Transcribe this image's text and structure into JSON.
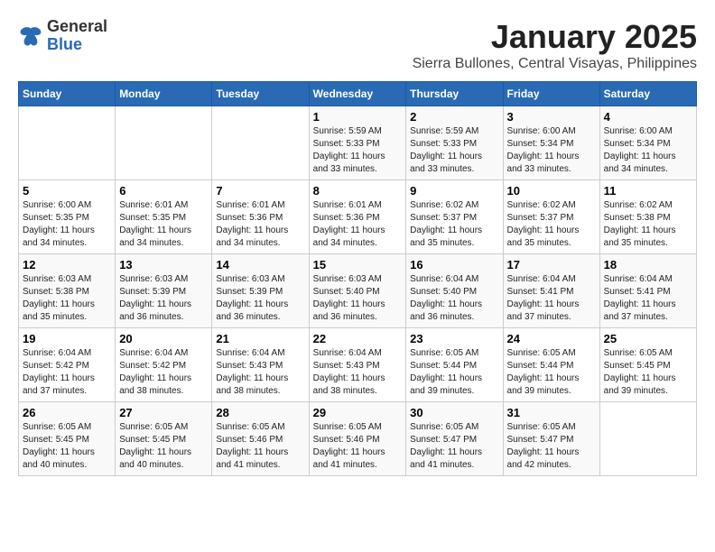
{
  "header": {
    "logo_general": "General",
    "logo_blue": "Blue",
    "month": "January 2025",
    "location": "Sierra Bullones, Central Visayas, Philippines"
  },
  "weekdays": [
    "Sunday",
    "Monday",
    "Tuesday",
    "Wednesday",
    "Thursday",
    "Friday",
    "Saturday"
  ],
  "weeks": [
    [
      {
        "day": "",
        "sunrise": "",
        "sunset": "",
        "daylight": ""
      },
      {
        "day": "",
        "sunrise": "",
        "sunset": "",
        "daylight": ""
      },
      {
        "day": "",
        "sunrise": "",
        "sunset": "",
        "daylight": ""
      },
      {
        "day": "1",
        "sunrise": "Sunrise: 5:59 AM",
        "sunset": "Sunset: 5:33 PM",
        "daylight": "Daylight: 11 hours and 33 minutes."
      },
      {
        "day": "2",
        "sunrise": "Sunrise: 5:59 AM",
        "sunset": "Sunset: 5:33 PM",
        "daylight": "Daylight: 11 hours and 33 minutes."
      },
      {
        "day": "3",
        "sunrise": "Sunrise: 6:00 AM",
        "sunset": "Sunset: 5:34 PM",
        "daylight": "Daylight: 11 hours and 33 minutes."
      },
      {
        "day": "4",
        "sunrise": "Sunrise: 6:00 AM",
        "sunset": "Sunset: 5:34 PM",
        "daylight": "Daylight: 11 hours and 34 minutes."
      }
    ],
    [
      {
        "day": "5",
        "sunrise": "Sunrise: 6:00 AM",
        "sunset": "Sunset: 5:35 PM",
        "daylight": "Daylight: 11 hours and 34 minutes."
      },
      {
        "day": "6",
        "sunrise": "Sunrise: 6:01 AM",
        "sunset": "Sunset: 5:35 PM",
        "daylight": "Daylight: 11 hours and 34 minutes."
      },
      {
        "day": "7",
        "sunrise": "Sunrise: 6:01 AM",
        "sunset": "Sunset: 5:36 PM",
        "daylight": "Daylight: 11 hours and 34 minutes."
      },
      {
        "day": "8",
        "sunrise": "Sunrise: 6:01 AM",
        "sunset": "Sunset: 5:36 PM",
        "daylight": "Daylight: 11 hours and 34 minutes."
      },
      {
        "day": "9",
        "sunrise": "Sunrise: 6:02 AM",
        "sunset": "Sunset: 5:37 PM",
        "daylight": "Daylight: 11 hours and 35 minutes."
      },
      {
        "day": "10",
        "sunrise": "Sunrise: 6:02 AM",
        "sunset": "Sunset: 5:37 PM",
        "daylight": "Daylight: 11 hours and 35 minutes."
      },
      {
        "day": "11",
        "sunrise": "Sunrise: 6:02 AM",
        "sunset": "Sunset: 5:38 PM",
        "daylight": "Daylight: 11 hours and 35 minutes."
      }
    ],
    [
      {
        "day": "12",
        "sunrise": "Sunrise: 6:03 AM",
        "sunset": "Sunset: 5:38 PM",
        "daylight": "Daylight: 11 hours and 35 minutes."
      },
      {
        "day": "13",
        "sunrise": "Sunrise: 6:03 AM",
        "sunset": "Sunset: 5:39 PM",
        "daylight": "Daylight: 11 hours and 36 minutes."
      },
      {
        "day": "14",
        "sunrise": "Sunrise: 6:03 AM",
        "sunset": "Sunset: 5:39 PM",
        "daylight": "Daylight: 11 hours and 36 minutes."
      },
      {
        "day": "15",
        "sunrise": "Sunrise: 6:03 AM",
        "sunset": "Sunset: 5:40 PM",
        "daylight": "Daylight: 11 hours and 36 minutes."
      },
      {
        "day": "16",
        "sunrise": "Sunrise: 6:04 AM",
        "sunset": "Sunset: 5:40 PM",
        "daylight": "Daylight: 11 hours and 36 minutes."
      },
      {
        "day": "17",
        "sunrise": "Sunrise: 6:04 AM",
        "sunset": "Sunset: 5:41 PM",
        "daylight": "Daylight: 11 hours and 37 minutes."
      },
      {
        "day": "18",
        "sunrise": "Sunrise: 6:04 AM",
        "sunset": "Sunset: 5:41 PM",
        "daylight": "Daylight: 11 hours and 37 minutes."
      }
    ],
    [
      {
        "day": "19",
        "sunrise": "Sunrise: 6:04 AM",
        "sunset": "Sunset: 5:42 PM",
        "daylight": "Daylight: 11 hours and 37 minutes."
      },
      {
        "day": "20",
        "sunrise": "Sunrise: 6:04 AM",
        "sunset": "Sunset: 5:42 PM",
        "daylight": "Daylight: 11 hours and 38 minutes."
      },
      {
        "day": "21",
        "sunrise": "Sunrise: 6:04 AM",
        "sunset": "Sunset: 5:43 PM",
        "daylight": "Daylight: 11 hours and 38 minutes."
      },
      {
        "day": "22",
        "sunrise": "Sunrise: 6:04 AM",
        "sunset": "Sunset: 5:43 PM",
        "daylight": "Daylight: 11 hours and 38 minutes."
      },
      {
        "day": "23",
        "sunrise": "Sunrise: 6:05 AM",
        "sunset": "Sunset: 5:44 PM",
        "daylight": "Daylight: 11 hours and 39 minutes."
      },
      {
        "day": "24",
        "sunrise": "Sunrise: 6:05 AM",
        "sunset": "Sunset: 5:44 PM",
        "daylight": "Daylight: 11 hours and 39 minutes."
      },
      {
        "day": "25",
        "sunrise": "Sunrise: 6:05 AM",
        "sunset": "Sunset: 5:45 PM",
        "daylight": "Daylight: 11 hours and 39 minutes."
      }
    ],
    [
      {
        "day": "26",
        "sunrise": "Sunrise: 6:05 AM",
        "sunset": "Sunset: 5:45 PM",
        "daylight": "Daylight: 11 hours and 40 minutes."
      },
      {
        "day": "27",
        "sunrise": "Sunrise: 6:05 AM",
        "sunset": "Sunset: 5:45 PM",
        "daylight": "Daylight: 11 hours and 40 minutes."
      },
      {
        "day": "28",
        "sunrise": "Sunrise: 6:05 AM",
        "sunset": "Sunset: 5:46 PM",
        "daylight": "Daylight: 11 hours and 41 minutes."
      },
      {
        "day": "29",
        "sunrise": "Sunrise: 6:05 AM",
        "sunset": "Sunset: 5:46 PM",
        "daylight": "Daylight: 11 hours and 41 minutes."
      },
      {
        "day": "30",
        "sunrise": "Sunrise: 6:05 AM",
        "sunset": "Sunset: 5:47 PM",
        "daylight": "Daylight: 11 hours and 41 minutes."
      },
      {
        "day": "31",
        "sunrise": "Sunrise: 6:05 AM",
        "sunset": "Sunset: 5:47 PM",
        "daylight": "Daylight: 11 hours and 42 minutes."
      },
      {
        "day": "",
        "sunrise": "",
        "sunset": "",
        "daylight": ""
      }
    ]
  ]
}
